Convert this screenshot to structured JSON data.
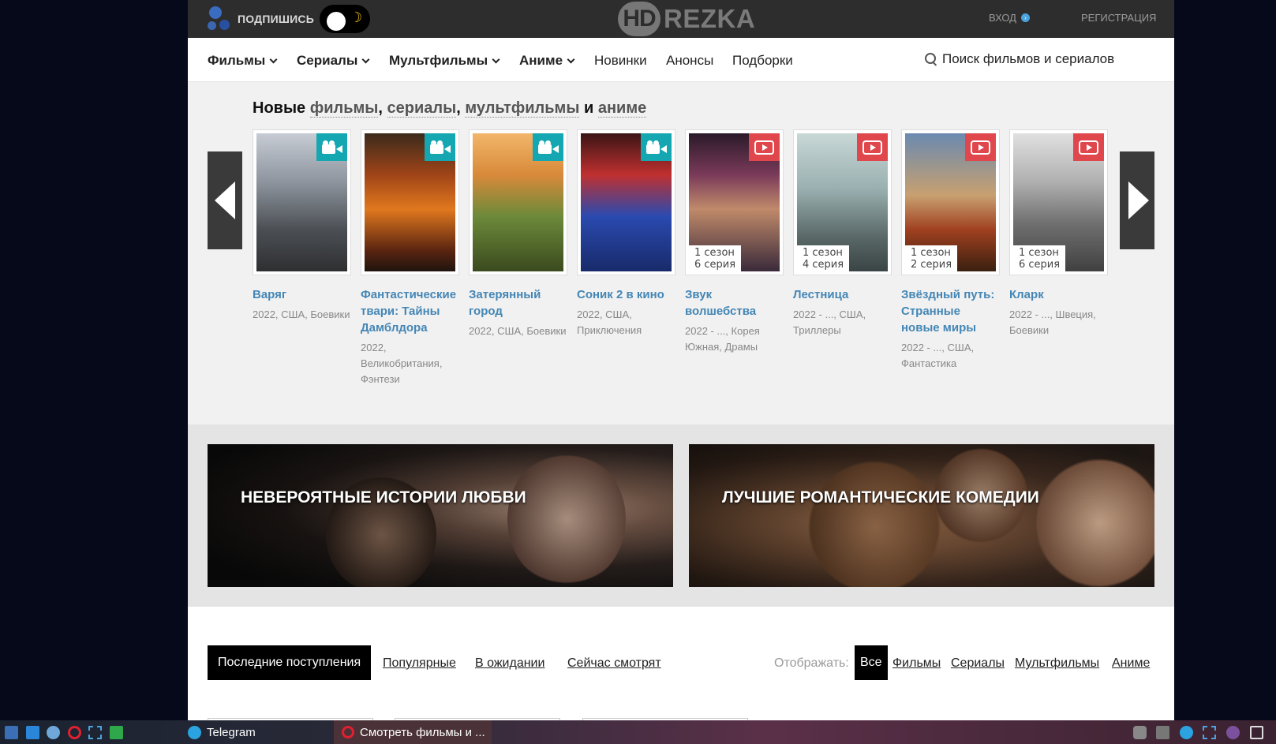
{
  "header": {
    "subscribe_label": "ПОДПИШИСЬ",
    "logo_hd": "HD",
    "logo_rezka": "REZKA",
    "login_label": "ВХОД",
    "register_label": "РЕГИСТРАЦИЯ"
  },
  "nav": {
    "films": "Фильмы",
    "series": "Сериалы",
    "cartoons": "Мультфильмы",
    "anime": "Аниме",
    "new": "Новинки",
    "announces": "Анонсы",
    "collections": "Подборки",
    "search_placeholder": "Поиск фильмов и сериалов"
  },
  "new_section": {
    "title_prefix": "Новые ",
    "link_films": "фильмы",
    "sep1": ", ",
    "link_series": "сериалы",
    "sep2": ", ",
    "link_cartoons": "мультфильмы",
    "and": " и ",
    "link_anime": "аниме",
    "items": [
      {
        "title": "Варяг",
        "meta": "2022, США, Боевики",
        "badge": "camera-icon",
        "season": "",
        "episode": ""
      },
      {
        "title": "Фантастические твари: Тайны Дамблдора",
        "meta": "2022, Великобритания, Фэнтези",
        "badge": "camera-icon",
        "season": "",
        "episode": ""
      },
      {
        "title": "Затерянный город",
        "meta": "2022, США, Боевики",
        "badge": "camera-icon",
        "season": "",
        "episode": ""
      },
      {
        "title": "Соник 2 в кино",
        "meta": "2022, США, Приключения",
        "badge": "camera-icon",
        "season": "",
        "episode": ""
      },
      {
        "title": "Звук волшебства",
        "meta": "2022 - ..., Корея Южная, Драмы",
        "badge": "play-icon",
        "season": "1 сезон",
        "episode": "6 серия"
      },
      {
        "title": "Лестница",
        "meta": "2022 - ..., США, Триллеры",
        "badge": "play-icon",
        "season": "1 сезон",
        "episode": "4 серия"
      },
      {
        "title": "Звёздный путь: Странные новые миры",
        "meta": "2022 - ..., США, Фантастика",
        "badge": "play-icon",
        "season": "1 сезон",
        "episode": "2 серия"
      },
      {
        "title": "Кларк",
        "meta": "2022 - ..., Швеция, Боевики",
        "badge": "play-icon",
        "season": "1 сезон",
        "episode": "6 серия"
      }
    ]
  },
  "collections": {
    "left": "НЕВЕРОЯТНЫЕ ИСТОРИИ ЛЮБВИ",
    "right": "ЛУЧШИЕ РОМАНТИЧЕСКИЕ КОМЕДИИ"
  },
  "tabs": {
    "latest": "Последние поступления",
    "popular": "Популярные",
    "waiting": "В ожидании",
    "watching": "Сейчас смотрят",
    "show_label": "Отображать:",
    "filter_all": "Все",
    "filter_films": "Фильмы",
    "filter_series": "Сериалы",
    "filter_cartoons": "Мультфильмы",
    "filter_anime": "Аниме"
  },
  "taskbar": {
    "telegram": "Telegram",
    "browser": "Смотреть фильмы и ..."
  },
  "colors": {
    "accent_link": "#4486b5",
    "badge_camera": "#14a7b1",
    "badge_play": "#e0474c",
    "topbar": "#2d2d2d"
  }
}
